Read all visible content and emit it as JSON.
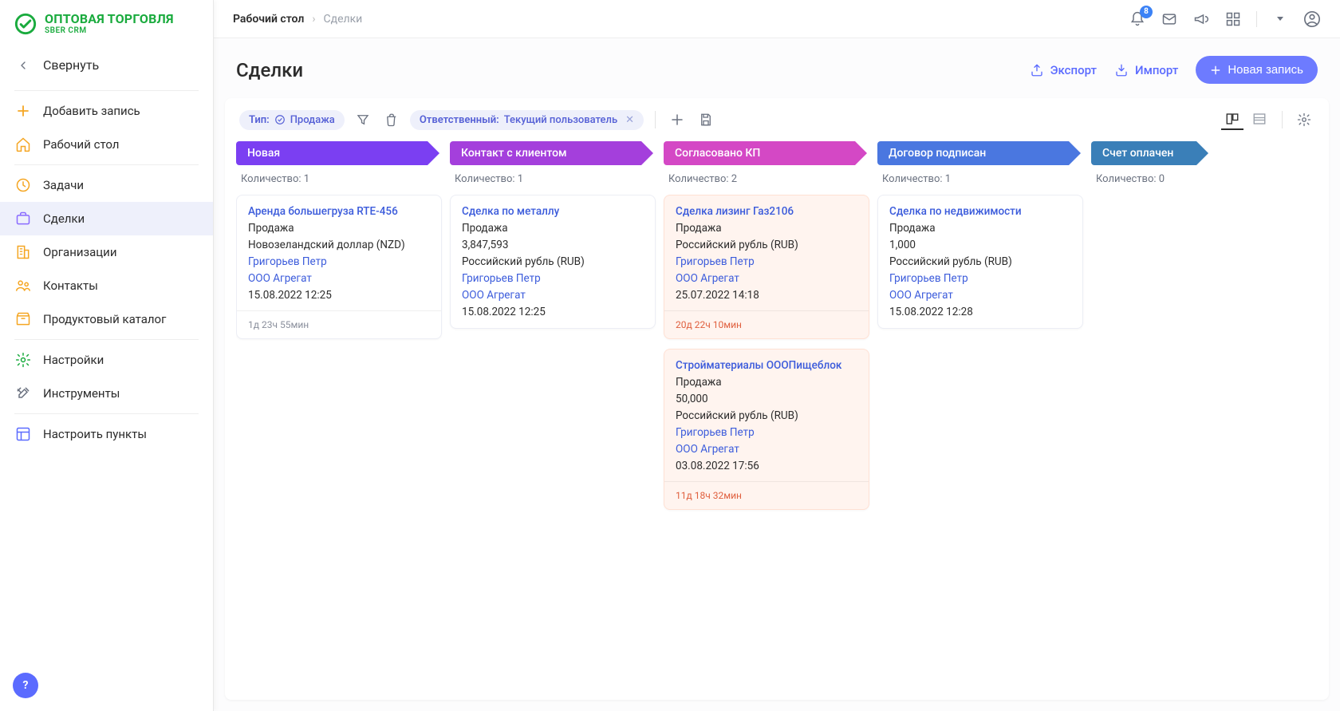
{
  "app": {
    "title": "ОПТОВАЯ ТОРГОВЛЯ",
    "subtitle": "SBER CRM"
  },
  "sidebar": {
    "collapse": "Свернуть",
    "add": "Добавить запись",
    "items": [
      {
        "label": "Рабочий стол"
      },
      {
        "label": "Задачи"
      },
      {
        "label": "Сделки"
      },
      {
        "label": "Организации"
      },
      {
        "label": "Контакты"
      },
      {
        "label": "Продуктовый каталог"
      }
    ],
    "settings": "Настройки",
    "tools": "Инструменты",
    "configure": "Настроить пункты"
  },
  "breadcrumb": {
    "root": "Рабочий стол",
    "current": "Сделки"
  },
  "notifications_count": "8",
  "page": {
    "title": "Сделки",
    "export": "Экспорт",
    "import": "Импорт",
    "newRecord": "Новая запись"
  },
  "filters": {
    "type_label": "Тип:",
    "type_value": "Продажа",
    "resp_label": "Ответственный:",
    "resp_value": "Текущий пользователь"
  },
  "count_prefix": "Количество: ",
  "columns": [
    {
      "title": "Новая",
      "count": "1"
    },
    {
      "title": "Контакт с клиентом",
      "count": "1"
    },
    {
      "title": "Согласовано КП",
      "count": "2"
    },
    {
      "title": "Договор подписан",
      "count": "1"
    },
    {
      "title": "Счет оплачен",
      "count": "0"
    }
  ],
  "cards": {
    "c0_0": {
      "title": "Аренда большегруза RTE-456",
      "type": "Продажа",
      "currency": "Новозеландский доллар (NZD)",
      "owner": "Григорьев Петр",
      "org": "ООО Агрегат",
      "date": "15.08.2022 12:25",
      "footer": "1д 23ч 55мин"
    },
    "c1_0": {
      "title": "Сделка по металлу",
      "type": "Продажа",
      "amount": "3,847,593",
      "currency": "Российский рубль (RUB)",
      "owner": "Григорьев Петр",
      "org": "ООО Агрегат",
      "date": "15.08.2022 12:25"
    },
    "c2_0": {
      "title": "Сделка лизинг Газ2106",
      "type": "Продажа",
      "currency": "Российский рубль (RUB)",
      "owner": "Григорьев Петр",
      "org": "ООО Агрегат",
      "date": "25.07.2022 14:18",
      "footer": "20д 22ч 10мин"
    },
    "c2_1": {
      "title": "Стройматериалы ОООПищеблок",
      "type": "Продажа",
      "amount": "50,000",
      "currency": "Российский рубль (RUB)",
      "owner": "Григорьев Петр",
      "org": "ООО Агрегат",
      "date": "03.08.2022 17:56",
      "footer": "11д 18ч 32мин"
    },
    "c3_0": {
      "title": "Сделка по недвижимости",
      "type": "Продажа",
      "amount": "1,000",
      "currency": "Российский рубль (RUB)",
      "owner": "Григорьев Петр",
      "org": "ООО Агрегат",
      "date": "15.08.2022 12:28"
    }
  }
}
